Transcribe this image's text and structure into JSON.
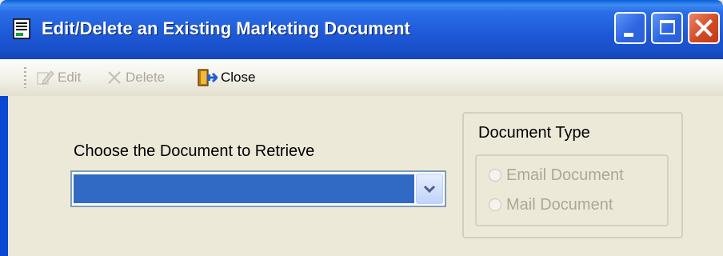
{
  "window": {
    "title": "Edit/Delete an Existing Marketing Document",
    "icon": "document-icon",
    "controls": [
      "minimize-icon",
      "maximize-icon",
      "close-icon"
    ]
  },
  "toolbar": {
    "edit_label": "Edit",
    "delete_label": "Delete",
    "close_label": "Close"
  },
  "form": {
    "choose_label": "Choose the Document to Retrieve",
    "document_select_value": ""
  },
  "document_type": {
    "title": "Document Type",
    "options": [
      {
        "label": "Email Document",
        "selected": false,
        "enabled": false
      },
      {
        "label": "Mail Document",
        "selected": false,
        "enabled": false
      }
    ]
  },
  "colors": {
    "title_bar": "#1d58d6",
    "select_highlight": "#316ac5",
    "close_button": "#d24a25",
    "disabled_text": "#aca899",
    "window_bg": "#ece9d8"
  }
}
